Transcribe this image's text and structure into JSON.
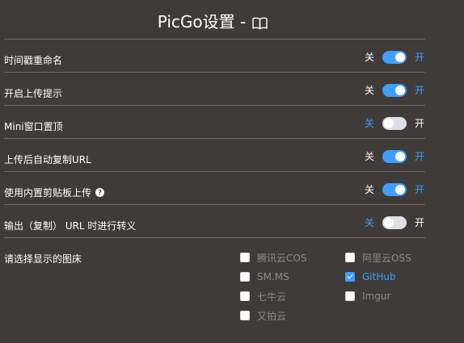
{
  "header": {
    "title": "PicGo设置 -",
    "icon": "book-open-icon"
  },
  "switch_labels": {
    "off": "关",
    "on": "开"
  },
  "settings": [
    {
      "label": "时间戳重命名",
      "enabled": true
    },
    {
      "label": "开启上传提示",
      "enabled": true
    },
    {
      "label": "Mini窗口置顶",
      "enabled": false
    },
    {
      "label": "上传后自动复制URL",
      "enabled": true
    },
    {
      "label": "使用内置剪贴板上传",
      "enabled": true,
      "help_icon": "question-circle-icon"
    },
    {
      "label": "输出（复制） URL 时进行转义",
      "enabled": false
    }
  ],
  "picbeds": {
    "label": "请选择显示的图床",
    "options": [
      {
        "label": "腾讯云COS",
        "checked": false
      },
      {
        "label": "阿里云OSS",
        "checked": false
      },
      {
        "label": "SM.MS",
        "checked": false
      },
      {
        "label": "GitHub",
        "checked": true
      },
      {
        "label": "七牛云",
        "checked": false
      },
      {
        "label": "Imgur",
        "checked": false
      },
      {
        "label": "又拍云",
        "checked": false
      }
    ]
  },
  "colors": {
    "background": "#3e3b38",
    "accent": "#409eff",
    "divider": "#6d6a66"
  }
}
